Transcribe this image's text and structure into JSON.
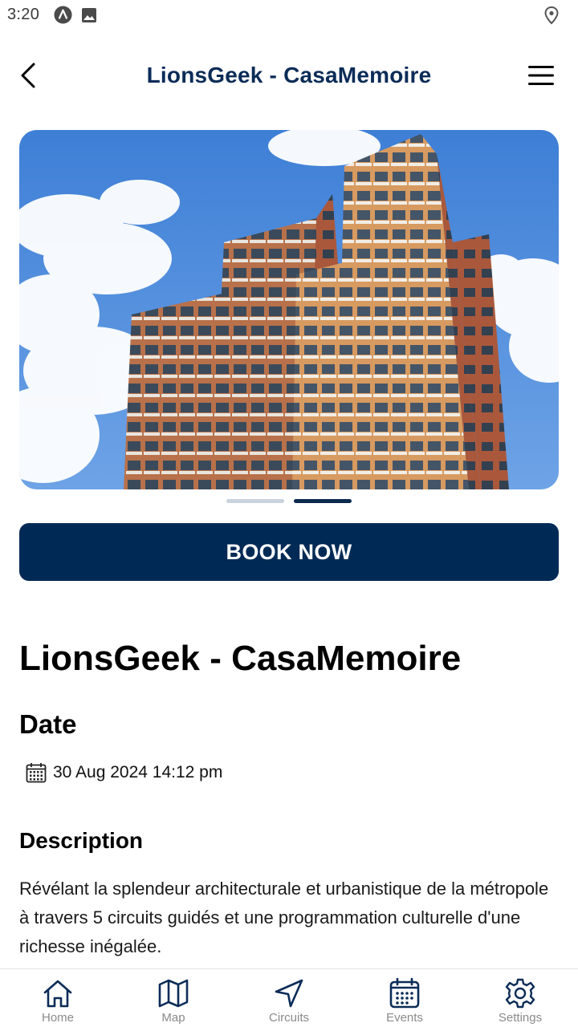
{
  "status_bar": {
    "time": "3:20"
  },
  "app_bar": {
    "title": "LionsGeek - CasaMemoire"
  },
  "carousel": {
    "current_index": 2,
    "total": 2
  },
  "book_button": {
    "label": "BOOK NOW"
  },
  "event": {
    "title": "LionsGeek - CasaMemoire",
    "date_heading": "Date",
    "date_value": "30 Aug 2024 14:12 pm",
    "description_heading": "Description",
    "description": "Révélant la splendeur architecturale et urbanistique de la métropole à travers 5 circuits guidés et une programmation culturelle d'une richesse inégalée."
  },
  "bottom_nav": {
    "items": [
      {
        "label": "Home",
        "icon": "home-icon"
      },
      {
        "label": "Map",
        "icon": "map-icon"
      },
      {
        "label": "Circuits",
        "icon": "navigation-arrow-icon"
      },
      {
        "label": "Events",
        "icon": "calendar-icon"
      },
      {
        "label": "Settings",
        "icon": "gear-icon"
      }
    ]
  },
  "colors": {
    "primary": "#002a56",
    "title_blue": "#0b2c57",
    "nav_icon": "#0b2c57",
    "nav_label": "#8a8a8a"
  }
}
